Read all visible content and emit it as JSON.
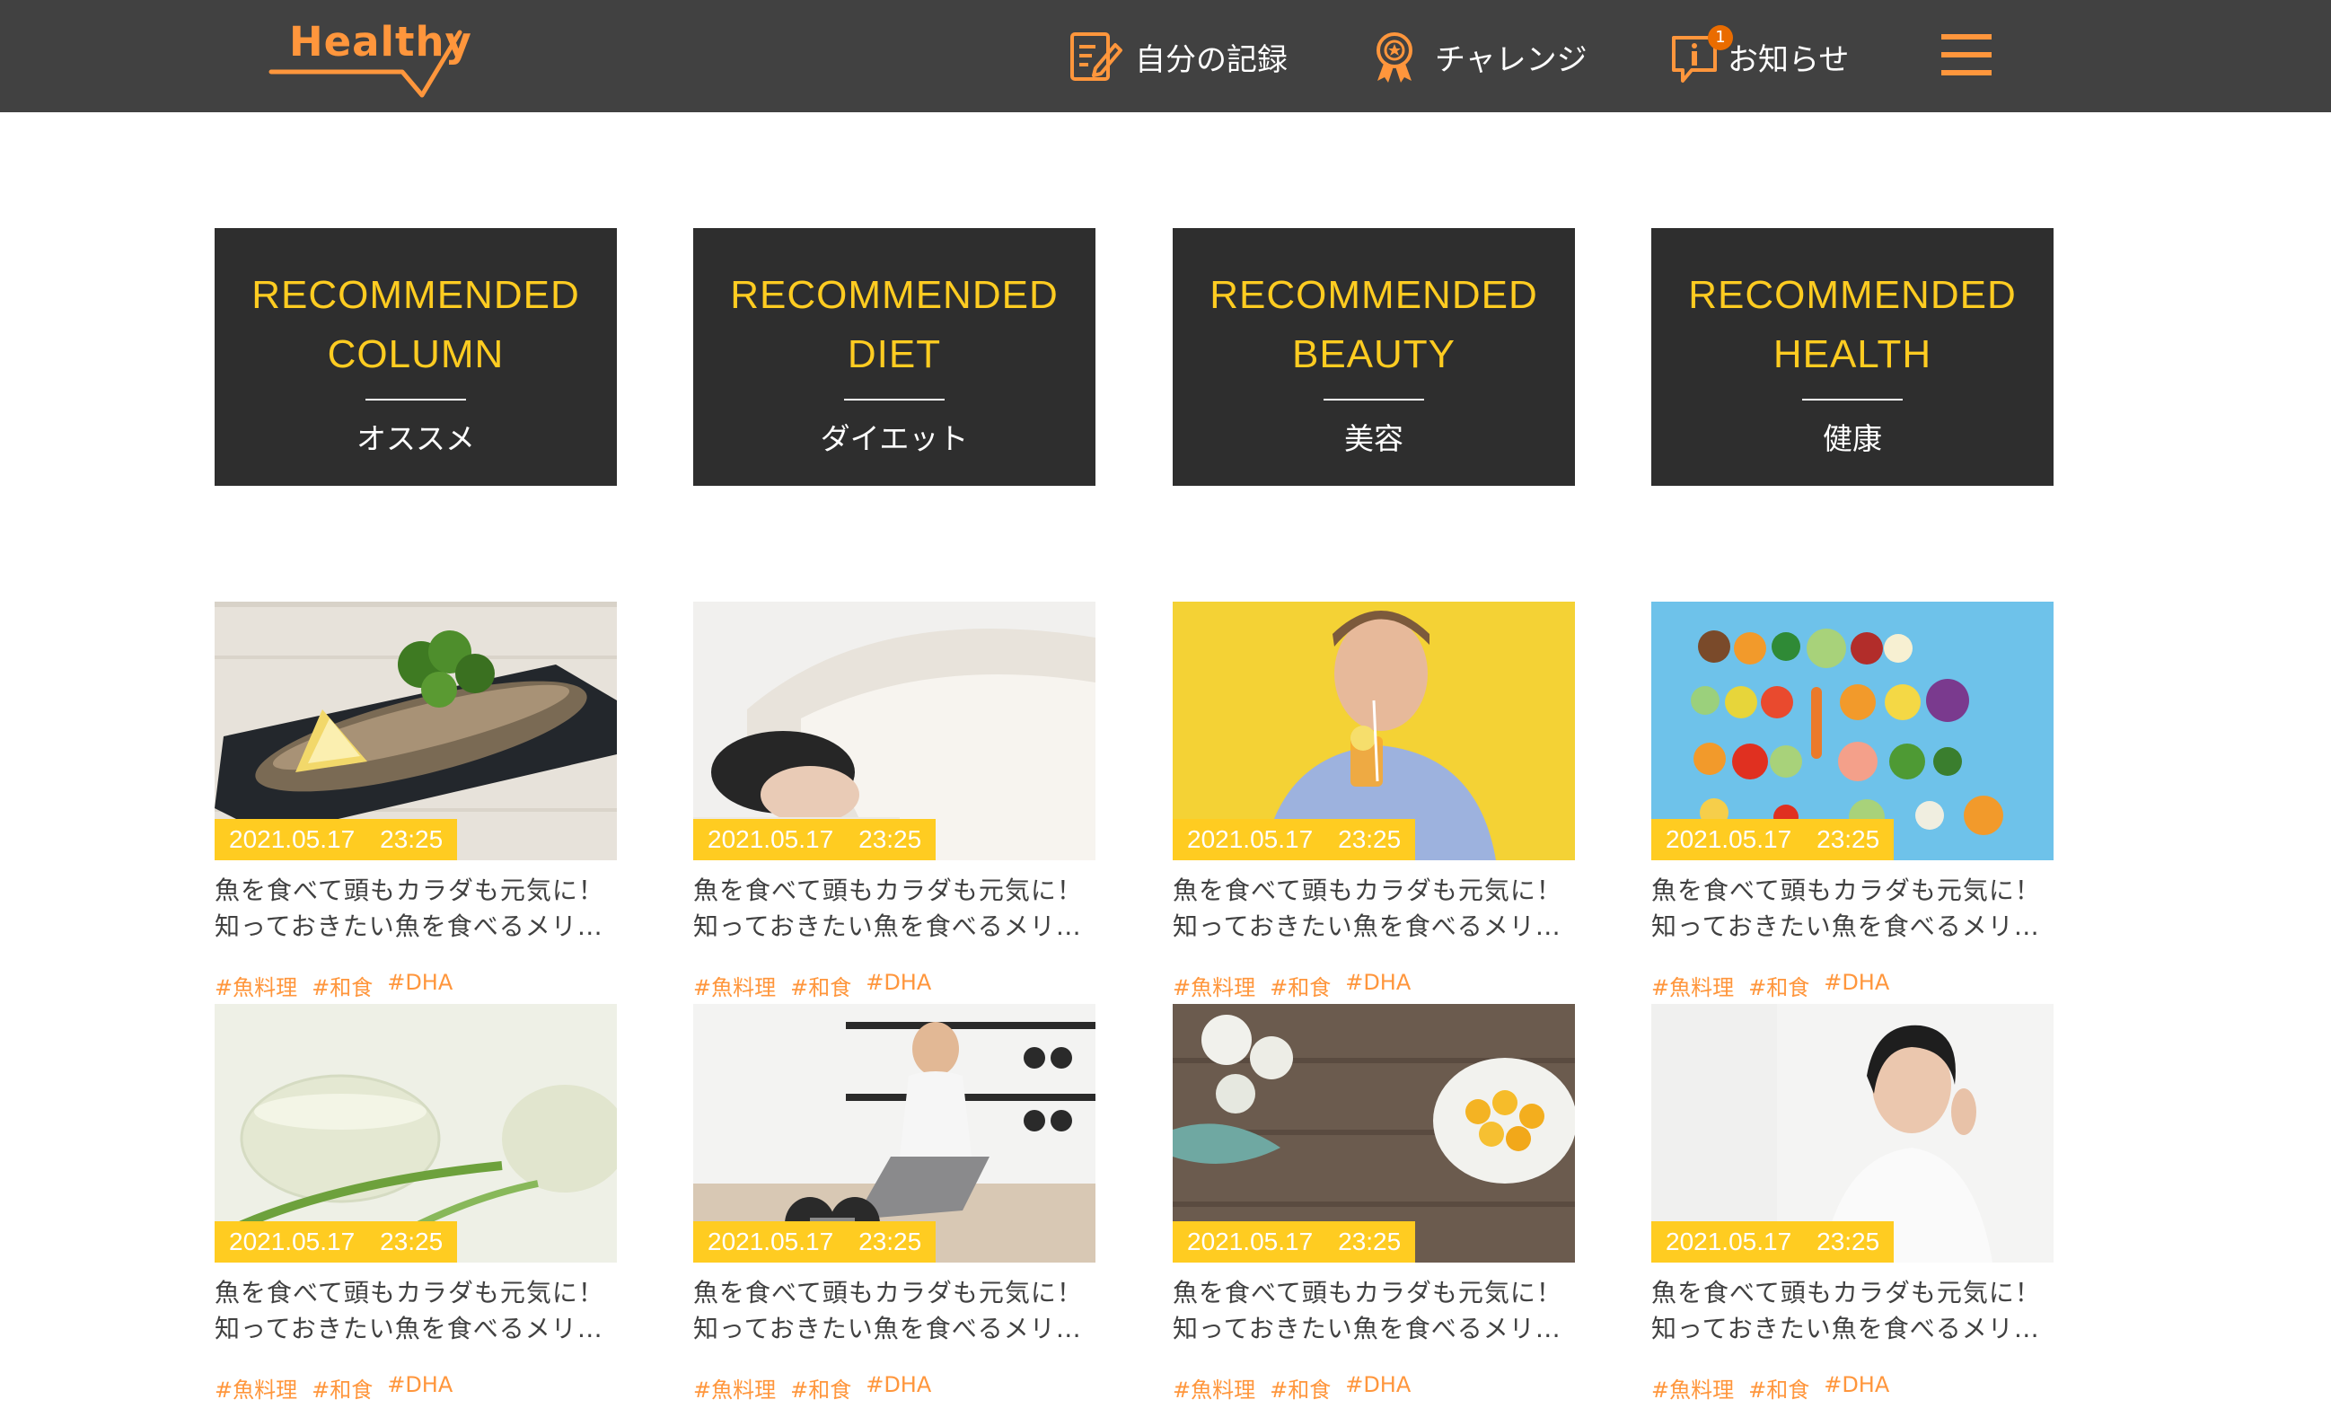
{
  "colors": {
    "header_bg": "#414141",
    "accent_orange": "#FF963C",
    "accent_yellow": "#FFCC21",
    "box_bg": "#2E2E2E",
    "text": "#414141"
  },
  "header": {
    "logo": "Healthy",
    "nav": [
      {
        "label": "自分の記録",
        "icon": "memo-icon"
      },
      {
        "label": "チャレンジ",
        "icon": "medal-icon"
      },
      {
        "label": "お知らせ",
        "icon": "info-icon",
        "badge": "1"
      }
    ],
    "menu_icon": "hamburger-menu-icon"
  },
  "recommended": [
    {
      "title": "RECOMMENDED\nCOLUMN",
      "subtitle": "オススメ"
    },
    {
      "title": "RECOMMENDED\nDIET",
      "subtitle": "ダイエット"
    },
    {
      "title": "RECOMMENDED\nBEAUTY",
      "subtitle": "美容"
    },
    {
      "title": "RECOMMENDED\nHEALTH",
      "subtitle": "健康"
    }
  ],
  "articles": [
    {
      "date": "2021.05.17　23:25",
      "title": "魚を食べて頭もカラダも元気に！知っておきたい魚を食べるメリ…",
      "tags": [
        "#魚料理",
        "#和食",
        "#DHA"
      ]
    },
    {
      "date": "2021.05.17　23:25",
      "title": "魚を食べて頭もカラダも元気に！知っておきたい魚を食べるメリ…",
      "tags": [
        "#魚料理",
        "#和食",
        "#DHA"
      ]
    },
    {
      "date": "2021.05.17　23:25",
      "title": "魚を食べて頭もカラダも元気に！知っておきたい魚を食べるメリ…",
      "tags": [
        "#魚料理",
        "#和食",
        "#DHA"
      ]
    },
    {
      "date": "2021.05.17　23:25",
      "title": "魚を食べて頭もカラダも元気に！知っておきたい魚を食べるメリ…",
      "tags": [
        "#魚料理",
        "#和食",
        "#DHA"
      ]
    },
    {
      "date": "2021.05.17　23:25",
      "title": "魚を食べて頭もカラダも元気に！知っておきたい魚を食べるメリ…",
      "tags": [
        "#魚料理",
        "#和食",
        "#DHA"
      ]
    },
    {
      "date": "2021.05.17　23:25",
      "title": "魚を食べて頭もカラダも元気に！知っておきたい魚を食べるメリ…",
      "tags": [
        "#魚料理",
        "#和食",
        "#DHA"
      ]
    },
    {
      "date": "2021.05.17　23:25",
      "title": "魚を食べて頭もカラダも元気に！知っておきたい魚を食べるメリ…",
      "tags": [
        "#魚料理",
        "#和食",
        "#DHA"
      ]
    },
    {
      "date": "2021.05.17　23:25",
      "title": "魚を食べて頭もカラダも元気に！知っておきたい魚を食べるメリ…",
      "tags": [
        "#魚料理",
        "#和食",
        "#DHA"
      ]
    }
  ]
}
